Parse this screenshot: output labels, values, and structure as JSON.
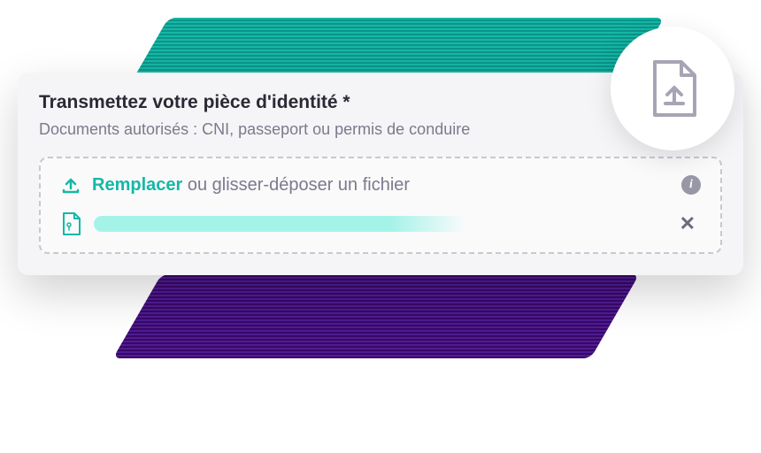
{
  "card": {
    "title": "Transmettez votre pièce d'identité *",
    "subtitle": "Documents autorisés : CNI, passeport ou permis de conduire"
  },
  "dropzone": {
    "replace_label": "Remplacer",
    "drag_label": " ou glisser-déposer un fichier"
  },
  "icons": {
    "upload": "upload",
    "info": "i",
    "pdf": "pdf",
    "close": "✕",
    "file_upload": "file-upload"
  },
  "colors": {
    "accent": "#14b8a6",
    "text_muted": "#7a7a8c",
    "text_dark": "#2a2a35"
  }
}
